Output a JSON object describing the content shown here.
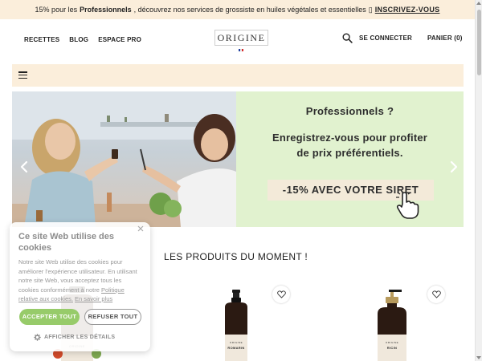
{
  "announcement": {
    "discount": "15% pour les",
    "audience": "Professionnels",
    "message": ", découvrez nos services de grossiste en huiles végétales et essentielles",
    "separator": "▯",
    "cta": "INSCRIVEZ-VOUS"
  },
  "header": {
    "nav_left": [
      "RECETTES",
      "BLOG",
      "ESPACE PRO"
    ],
    "logo": "ORIGINE",
    "login": "SE CONNECTER",
    "cart": "PANIER (0)"
  },
  "hero": {
    "title": "Professionnels ?",
    "line1": "Enregistrez-vous pour profiter",
    "line2": "de prix préférentiels.",
    "offer": "-15% AVEC VOTRE SIRET"
  },
  "products_section": {
    "title": "LES PRODUITS DU MOMENT !",
    "items": [
      {
        "brand": "ORIGINE",
        "name": "ROMARIN"
      },
      {
        "brand": "ORIGINE",
        "name": "RICIN"
      }
    ]
  },
  "cookie_banner": {
    "title": "Ce site Web utilise des cookies",
    "body": "Notre site Web utilise des cookies pour améliorer l'expérience utilisateur. En utilisant notre site Web, vous acceptez tous les cookies conformément à notre ",
    "policy_link": "Politique relative aux cookies.",
    "read_more": "En savoir plus",
    "accept": "ACCEPTER TOUT",
    "refuse": "REFUSER TOUT",
    "details": "AFFICHER LES DÉTAILS"
  },
  "background_product": {
    "brand": "ORIGINE"
  },
  "colors": {
    "accent_bg": "#fbeedb",
    "hero_bg": "#e1f2cf",
    "accept_green": "#97cb6a"
  }
}
